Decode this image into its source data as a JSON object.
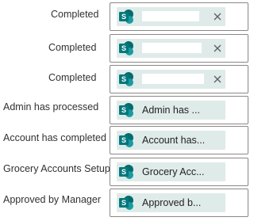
{
  "rows": [
    {
      "label": "Completed",
      "value": ""
    },
    {
      "label": "Completed",
      "value": ""
    },
    {
      "label": "Completed",
      "value": ""
    },
    {
      "label": "Admin has processed",
      "value": "Admin has ..."
    },
    {
      "label": "Account has completed",
      "value": "Account has..."
    },
    {
      "label": "Grocery Accounts Setup",
      "value": "Grocery Acc..."
    },
    {
      "label": "Approved by Manager",
      "value": "Approved b..."
    }
  ],
  "icons": {
    "token": "sharepoint-icon",
    "remove": "close-icon"
  },
  "colors": {
    "token_bg": "#dfebe9",
    "icon_teal": "#036c70",
    "border": "#8a8886"
  }
}
